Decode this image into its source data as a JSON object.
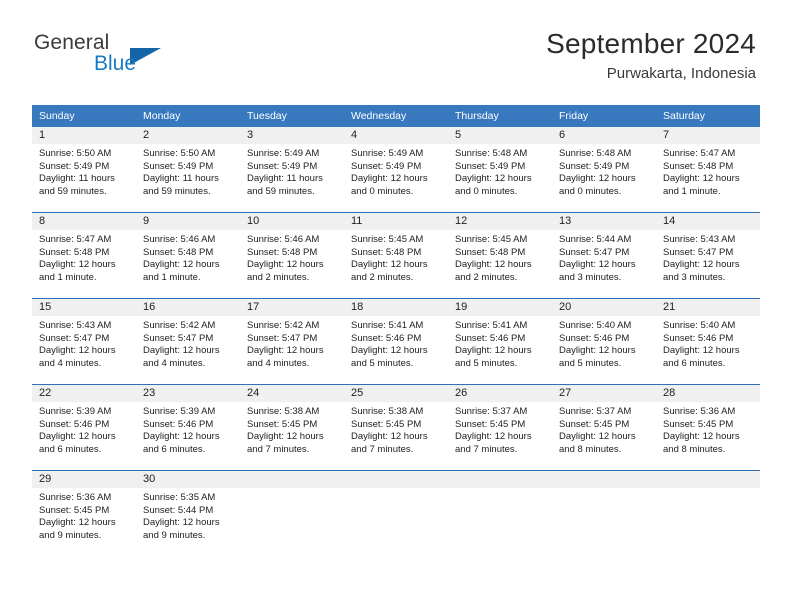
{
  "brand": {
    "name_top": "General",
    "name_bottom": "Blue",
    "accent_color": "#1464aa",
    "accent_color_light": "#1a7bc4"
  },
  "header": {
    "title": "September 2024",
    "subtitle": "Purwakarta, Indonesia"
  },
  "colors": {
    "header_row_bg": "#3878bf",
    "header_row_text": "#ffffff",
    "day_band_bg": "#f0f0f0",
    "row_border": "#2f6fb5",
    "cell_bg": "#ffffff",
    "body_text": "#1e1e1e"
  },
  "weekday_headers": [
    "Sunday",
    "Monday",
    "Tuesday",
    "Wednesday",
    "Thursday",
    "Friday",
    "Saturday"
  ],
  "weeks": [
    [
      {
        "day": "1",
        "sunrise": "Sunrise: 5:50 AM",
        "sunset": "Sunset: 5:49 PM",
        "daylight_line1": "Daylight: 11 hours",
        "daylight_line2": "and 59 minutes."
      },
      {
        "day": "2",
        "sunrise": "Sunrise: 5:50 AM",
        "sunset": "Sunset: 5:49 PM",
        "daylight_line1": "Daylight: 11 hours",
        "daylight_line2": "and 59 minutes."
      },
      {
        "day": "3",
        "sunrise": "Sunrise: 5:49 AM",
        "sunset": "Sunset: 5:49 PM",
        "daylight_line1": "Daylight: 11 hours",
        "daylight_line2": "and 59 minutes."
      },
      {
        "day": "4",
        "sunrise": "Sunrise: 5:49 AM",
        "sunset": "Sunset: 5:49 PM",
        "daylight_line1": "Daylight: 12 hours",
        "daylight_line2": "and 0 minutes."
      },
      {
        "day": "5",
        "sunrise": "Sunrise: 5:48 AM",
        "sunset": "Sunset: 5:49 PM",
        "daylight_line1": "Daylight: 12 hours",
        "daylight_line2": "and 0 minutes."
      },
      {
        "day": "6",
        "sunrise": "Sunrise: 5:48 AM",
        "sunset": "Sunset: 5:49 PM",
        "daylight_line1": "Daylight: 12 hours",
        "daylight_line2": "and 0 minutes."
      },
      {
        "day": "7",
        "sunrise": "Sunrise: 5:47 AM",
        "sunset": "Sunset: 5:48 PM",
        "daylight_line1": "Daylight: 12 hours",
        "daylight_line2": "and 1 minute."
      }
    ],
    [
      {
        "day": "8",
        "sunrise": "Sunrise: 5:47 AM",
        "sunset": "Sunset: 5:48 PM",
        "daylight_line1": "Daylight: 12 hours",
        "daylight_line2": "and 1 minute."
      },
      {
        "day": "9",
        "sunrise": "Sunrise: 5:46 AM",
        "sunset": "Sunset: 5:48 PM",
        "daylight_line1": "Daylight: 12 hours",
        "daylight_line2": "and 1 minute."
      },
      {
        "day": "10",
        "sunrise": "Sunrise: 5:46 AM",
        "sunset": "Sunset: 5:48 PM",
        "daylight_line1": "Daylight: 12 hours",
        "daylight_line2": "and 2 minutes."
      },
      {
        "day": "11",
        "sunrise": "Sunrise: 5:45 AM",
        "sunset": "Sunset: 5:48 PM",
        "daylight_line1": "Daylight: 12 hours",
        "daylight_line2": "and 2 minutes."
      },
      {
        "day": "12",
        "sunrise": "Sunrise: 5:45 AM",
        "sunset": "Sunset: 5:48 PM",
        "daylight_line1": "Daylight: 12 hours",
        "daylight_line2": "and 2 minutes."
      },
      {
        "day": "13",
        "sunrise": "Sunrise: 5:44 AM",
        "sunset": "Sunset: 5:47 PM",
        "daylight_line1": "Daylight: 12 hours",
        "daylight_line2": "and 3 minutes."
      },
      {
        "day": "14",
        "sunrise": "Sunrise: 5:43 AM",
        "sunset": "Sunset: 5:47 PM",
        "daylight_line1": "Daylight: 12 hours",
        "daylight_line2": "and 3 minutes."
      }
    ],
    [
      {
        "day": "15",
        "sunrise": "Sunrise: 5:43 AM",
        "sunset": "Sunset: 5:47 PM",
        "daylight_line1": "Daylight: 12 hours",
        "daylight_line2": "and 4 minutes."
      },
      {
        "day": "16",
        "sunrise": "Sunrise: 5:42 AM",
        "sunset": "Sunset: 5:47 PM",
        "daylight_line1": "Daylight: 12 hours",
        "daylight_line2": "and 4 minutes."
      },
      {
        "day": "17",
        "sunrise": "Sunrise: 5:42 AM",
        "sunset": "Sunset: 5:47 PM",
        "daylight_line1": "Daylight: 12 hours",
        "daylight_line2": "and 4 minutes."
      },
      {
        "day": "18",
        "sunrise": "Sunrise: 5:41 AM",
        "sunset": "Sunset: 5:46 PM",
        "daylight_line1": "Daylight: 12 hours",
        "daylight_line2": "and 5 minutes."
      },
      {
        "day": "19",
        "sunrise": "Sunrise: 5:41 AM",
        "sunset": "Sunset: 5:46 PM",
        "daylight_line1": "Daylight: 12 hours",
        "daylight_line2": "and 5 minutes."
      },
      {
        "day": "20",
        "sunrise": "Sunrise: 5:40 AM",
        "sunset": "Sunset: 5:46 PM",
        "daylight_line1": "Daylight: 12 hours",
        "daylight_line2": "and 5 minutes."
      },
      {
        "day": "21",
        "sunrise": "Sunrise: 5:40 AM",
        "sunset": "Sunset: 5:46 PM",
        "daylight_line1": "Daylight: 12 hours",
        "daylight_line2": "and 6 minutes."
      }
    ],
    [
      {
        "day": "22",
        "sunrise": "Sunrise: 5:39 AM",
        "sunset": "Sunset: 5:46 PM",
        "daylight_line1": "Daylight: 12 hours",
        "daylight_line2": "and 6 minutes."
      },
      {
        "day": "23",
        "sunrise": "Sunrise: 5:39 AM",
        "sunset": "Sunset: 5:46 PM",
        "daylight_line1": "Daylight: 12 hours",
        "daylight_line2": "and 6 minutes."
      },
      {
        "day": "24",
        "sunrise": "Sunrise: 5:38 AM",
        "sunset": "Sunset: 5:45 PM",
        "daylight_line1": "Daylight: 12 hours",
        "daylight_line2": "and 7 minutes."
      },
      {
        "day": "25",
        "sunrise": "Sunrise: 5:38 AM",
        "sunset": "Sunset: 5:45 PM",
        "daylight_line1": "Daylight: 12 hours",
        "daylight_line2": "and 7 minutes."
      },
      {
        "day": "26",
        "sunrise": "Sunrise: 5:37 AM",
        "sunset": "Sunset: 5:45 PM",
        "daylight_line1": "Daylight: 12 hours",
        "daylight_line2": "and 7 minutes."
      },
      {
        "day": "27",
        "sunrise": "Sunrise: 5:37 AM",
        "sunset": "Sunset: 5:45 PM",
        "daylight_line1": "Daylight: 12 hours",
        "daylight_line2": "and 8 minutes."
      },
      {
        "day": "28",
        "sunrise": "Sunrise: 5:36 AM",
        "sunset": "Sunset: 5:45 PM",
        "daylight_line1": "Daylight: 12 hours",
        "daylight_line2": "and 8 minutes."
      }
    ],
    [
      {
        "day": "29",
        "sunrise": "Sunrise: 5:36 AM",
        "sunset": "Sunset: 5:45 PM",
        "daylight_line1": "Daylight: 12 hours",
        "daylight_line2": "and 9 minutes."
      },
      {
        "day": "30",
        "sunrise": "Sunrise: 5:35 AM",
        "sunset": "Sunset: 5:44 PM",
        "daylight_line1": "Daylight: 12 hours",
        "daylight_line2": "and 9 minutes."
      },
      {
        "day": "",
        "sunrise": "",
        "sunset": "",
        "daylight_line1": "",
        "daylight_line2": ""
      },
      {
        "day": "",
        "sunrise": "",
        "sunset": "",
        "daylight_line1": "",
        "daylight_line2": ""
      },
      {
        "day": "",
        "sunrise": "",
        "sunset": "",
        "daylight_line1": "",
        "daylight_line2": ""
      },
      {
        "day": "",
        "sunrise": "",
        "sunset": "",
        "daylight_line1": "",
        "daylight_line2": ""
      },
      {
        "day": "",
        "sunrise": "",
        "sunset": "",
        "daylight_line1": "",
        "daylight_line2": ""
      }
    ]
  ]
}
